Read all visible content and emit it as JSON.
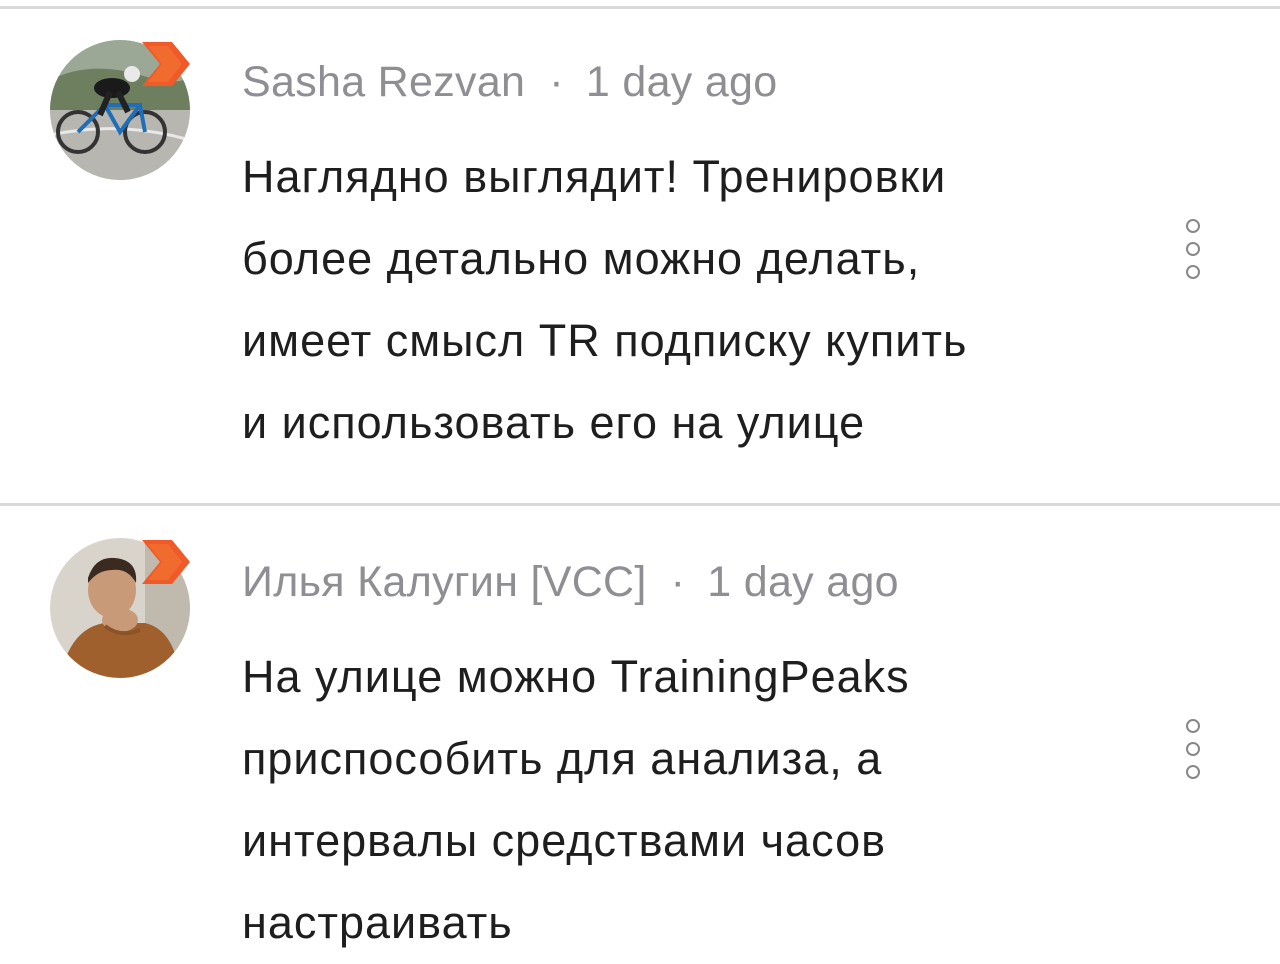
{
  "comments": [
    {
      "author": "Sasha Rezvan",
      "separator": "·",
      "time": "1 day ago",
      "lines": [
        "Наглядно выглядит! Тренировки",
        "более детально можно делать,",
        "имеет смысл TR подписку купить",
        "и использовать его на улице"
      ],
      "avatar_icon": "cyclist-avatar",
      "badge_icon": "chevron-badge-icon",
      "more_icon": "more-options-icon"
    },
    {
      "author": "Илья Калугин [VCC]",
      "separator": "·",
      "time": "1 day ago",
      "lines": [
        "На улице можно TrainingPeaks",
        "приспособить для анализа, а",
        "интервалы средствами часов",
        "настраивать"
      ],
      "avatar_icon": "person-avatar",
      "badge_icon": "chevron-badge-icon",
      "more_icon": "more-options-icon"
    }
  ],
  "colors": {
    "badge": "#f05a28",
    "meta_text": "#8e8e93",
    "body_text": "#1e1e1e",
    "divider": "#d9d9d9"
  }
}
